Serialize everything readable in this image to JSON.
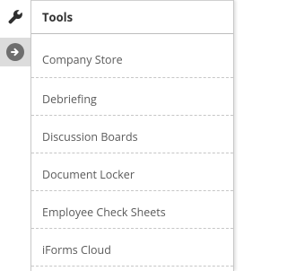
{
  "panel": {
    "title": "Tools"
  },
  "rail": {
    "icons": [
      "wrench-icon",
      "arrow-right-circle-icon"
    ]
  },
  "menu": {
    "items": [
      {
        "label": "Company Store"
      },
      {
        "label": "Debriefing"
      },
      {
        "label": "Discussion Boards"
      },
      {
        "label": "Document Locker"
      },
      {
        "label": "Employee Check Sheets"
      },
      {
        "label": "iForms Cloud"
      }
    ]
  },
  "colors": {
    "text": "#5a5a5a",
    "header_text": "#333333",
    "rail_active_bg": "#dcdcdc",
    "icon": "#3a3a3a",
    "divider": "#c6c6c6"
  }
}
